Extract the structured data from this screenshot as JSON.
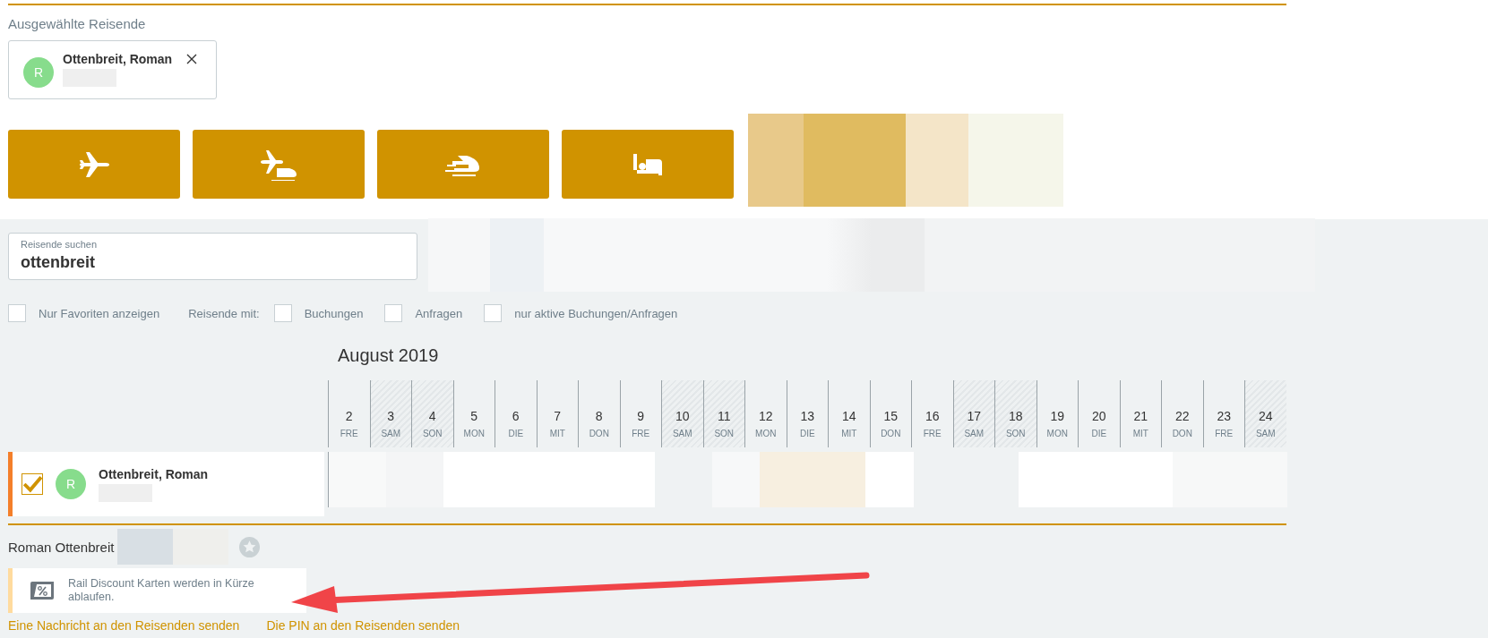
{
  "selected_travelers": {
    "title": "Ausgewählte Reisende",
    "chips": [
      {
        "initial": "R",
        "name": "Ottenbreit, Roman"
      }
    ]
  },
  "transport_buttons": [
    {
      "kind": "flight"
    },
    {
      "kind": "flight_rail"
    },
    {
      "kind": "rail"
    },
    {
      "kind": "hotel"
    }
  ],
  "search": {
    "label": "Reisende suchen",
    "value": "ottenbreit"
  },
  "filters": {
    "favorites": {
      "label": "Nur Favoriten anzeigen",
      "checked": false
    },
    "with_label": "Reisende mit:",
    "options": [
      {
        "label": "Buchungen",
        "checked": false
      },
      {
        "label": "Anfragen",
        "checked": false
      },
      {
        "label": "nur aktive Buchungen/Anfragen",
        "checked": false
      }
    ]
  },
  "calendar": {
    "month": "August 2019",
    "days": [
      {
        "day": "2",
        "weekday": "FRE",
        "weekend": false
      },
      {
        "day": "3",
        "weekday": "SAM",
        "weekend": true
      },
      {
        "day": "4",
        "weekday": "SON",
        "weekend": true
      },
      {
        "day": "5",
        "weekday": "MON",
        "weekend": false
      },
      {
        "day": "6",
        "weekday": "DIE",
        "weekend": false
      },
      {
        "day": "7",
        "weekday": "MIT",
        "weekend": false
      },
      {
        "day": "8",
        "weekday": "DON",
        "weekend": false
      },
      {
        "day": "9",
        "weekday": "FRE",
        "weekend": false
      },
      {
        "day": "10",
        "weekday": "SAM",
        "weekend": true
      },
      {
        "day": "11",
        "weekday": "SON",
        "weekend": true
      },
      {
        "day": "12",
        "weekday": "MON",
        "weekend": false
      },
      {
        "day": "13",
        "weekday": "DIE",
        "weekend": false
      },
      {
        "day": "14",
        "weekday": "MIT",
        "weekend": false
      },
      {
        "day": "15",
        "weekday": "DON",
        "weekend": false
      },
      {
        "day": "16",
        "weekday": "FRE",
        "weekend": false
      },
      {
        "day": "17",
        "weekday": "SAM",
        "weekend": true
      },
      {
        "day": "18",
        "weekday": "SON",
        "weekend": true
      },
      {
        "day": "19",
        "weekday": "MON",
        "weekend": false
      },
      {
        "day": "20",
        "weekday": "DIE",
        "weekend": false
      },
      {
        "day": "21",
        "weekday": "MIT",
        "weekend": false
      },
      {
        "day": "22",
        "weekday": "DON",
        "weekend": false
      },
      {
        "day": "23",
        "weekday": "FRE",
        "weekend": false
      },
      {
        "day": "24",
        "weekday": "SAM",
        "weekend": true
      }
    ],
    "rows": [
      {
        "initial": "R",
        "name": "Ottenbreit, Roman",
        "checked": true
      }
    ]
  },
  "profile": {
    "name": "Roman Ottenbreit"
  },
  "notice": {
    "text": "Rail Discount Karten werden in Kürze ablaufen."
  },
  "links": [
    "Eine Nachricht an den Reisenden senden",
    "Die PIN an den Reisenden senden"
  ]
}
